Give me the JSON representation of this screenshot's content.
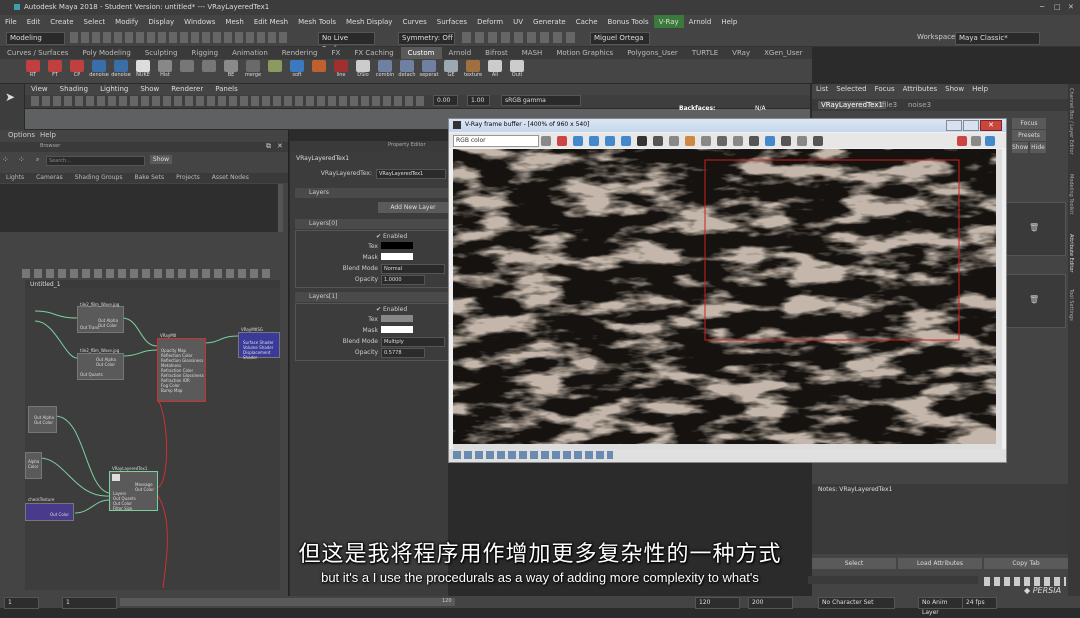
{
  "window": {
    "title": "Autodesk Maya 2018 - Student Version: untitled*  ---  VRayLayeredTex1",
    "workspace_label": "Workspace :",
    "workspace_value": "Maya Classic*"
  },
  "menu": [
    "File",
    "Edit",
    "Create",
    "Select",
    "Modify",
    "Display",
    "Windows",
    "Mesh",
    "Edit Mesh",
    "Mesh Tools",
    "Mesh Display",
    "Curves",
    "Surfaces",
    "Deform",
    "UV",
    "Generate",
    "Cache",
    "Bonus Tools",
    "V-Ray",
    "Arnold",
    "Help"
  ],
  "statusline": {
    "mode": "Modeling",
    "live_surface": "No Live Surface",
    "symmetry": "Symmetry: Off",
    "user": "Miguel Ortega"
  },
  "shelf_tabs": [
    "Curves / Surfaces",
    "Poly Modeling",
    "Sculpting",
    "Rigging",
    "Animation",
    "Rendering",
    "FX",
    "FX Caching",
    "Custom",
    "Arnold",
    "Bifrost",
    "MASH",
    "Motion Graphics",
    "Polygons_User",
    "TURTLE",
    "VRay",
    "XGen_User",
    "XGen"
  ],
  "shelf_active": "Custom",
  "shelf_buttons": [
    {
      "label": "RT",
      "color": "#c04040"
    },
    {
      "label": "FT",
      "color": "#c04040"
    },
    {
      "label": "CP",
      "color": "#c04040"
    },
    {
      "label": "denoise",
      "color": "#3a6ea8"
    },
    {
      "label": "denoise",
      "color": "#3a6ea8"
    },
    {
      "label": "NUKE",
      "color": "#dddddd"
    },
    {
      "label": "Hist",
      "color": "#888888"
    },
    {
      "label": "",
      "color": "#777777"
    },
    {
      "label": "",
      "color": "#777777"
    },
    {
      "label": "BE",
      "color": "#8a8a8a"
    },
    {
      "label": "merge",
      "color": "#6a6a6a"
    },
    {
      "label": "",
      "color": "#8a9a60"
    },
    {
      "label": "soft",
      "color": "#3a7ac0"
    },
    {
      "label": "",
      "color": "#c06030"
    },
    {
      "label": "line",
      "color": "#a03030"
    },
    {
      "label": "DSlo",
      "color": "#cccccc"
    },
    {
      "label": "combin",
      "color": "#7080a0"
    },
    {
      "label": "detach",
      "color": "#7080a0"
    },
    {
      "label": "seperat",
      "color": "#7080a0"
    },
    {
      "label": "GE",
      "color": "#9aaab0"
    },
    {
      "label": "texture",
      "color": "#a07040"
    },
    {
      "label": "All",
      "color": "#cccccc"
    },
    {
      "label": "Outl",
      "color": "#cccccc"
    }
  ],
  "panel_menu": [
    "View",
    "Shading",
    "Lighting",
    "Show",
    "Renderer",
    "Panels"
  ],
  "view_tools": {
    "exposure": "0.00",
    "gamma": "1.00",
    "color_space": "sRGB gamma"
  },
  "viewport": {
    "backfaces_label": "Backfaces:",
    "backfaces_value": "N/A"
  },
  "right_panel": {
    "menu": [
      "List",
      "Selected",
      "Focus",
      "Attributes",
      "Show",
      "Help"
    ],
    "tabs": [
      "VRayLayeredTex1",
      "file3",
      "noise3"
    ],
    "buttons": {
      "focus": "Focus",
      "presets": "Presets",
      "show": "Show",
      "hide": "Hide"
    },
    "notes_label": "Notes:  VRayLayeredTex1",
    "bottom_buttons": [
      "Select",
      "Load Attributes",
      "Copy Tab"
    ]
  },
  "side_labels": [
    "Channel Box / Layer Editor",
    "Modeling Toolkit",
    "Attribute Editor",
    "Tool Settings"
  ],
  "hypershade": {
    "menu": [
      "Options",
      "Help"
    ],
    "browser_label": "Browser",
    "search_placeholder": "Search...",
    "show_button": "Show",
    "tabs": [
      "Lights",
      "Cameras",
      "Shading Groups",
      "Bake Sets",
      "Projects",
      "Asset Nodes"
    ],
    "graph_tab": "Untitled_1"
  },
  "nodes": {
    "n1_title": "tile2_fBm_Wave.jpg",
    "n1_ports": [
      "Out Alpha",
      "Out Color",
      "Out Trans"
    ],
    "n2_title": "tile2_fBm_Wave.jpg",
    "n2_ports": [
      "Out Alpha",
      "Out Color",
      "Out Quants"
    ],
    "shader_title": "VRayMtl",
    "shader_ports": [
      "Opacity Map",
      "Reflection Color",
      "Reflection Glossiness",
      "Metalness",
      "Refraction Color",
      "Refraction Glossiness",
      "Refraction IOR",
      "Fog Color",
      "Bump Map"
    ],
    "sg_title": "VRayMtlSG",
    "sg_ports": [
      "Surface Shader",
      "Volume Shader",
      "Displacement Shader"
    ],
    "layered_title": "VRayLayeredTex1",
    "layered_ports": [
      "Layers",
      "Out Quants",
      "Out Color",
      "Filter Size"
    ],
    "layered_out": [
      "Message",
      "Out Color"
    ],
    "n3_ports": [
      "Out Alpha",
      "Out Color"
    ],
    "n4_ports": [
      "Alpha",
      "Color"
    ],
    "n5_title": "checkTexture",
    "n5_ports": [
      "Out Color"
    ]
  },
  "property_editor": {
    "title": "Property Editor",
    "node_name": "VRayLayeredTex1",
    "field_label": "VRayLayeredTex:",
    "field_value": "VRayLayeredTex1",
    "layers_section": "Layers",
    "add_new": "Add New Layer",
    "layer0": {
      "header": "Layers[0]",
      "enabled": "Enabled",
      "tex": "Tex",
      "mask": "Mask",
      "blend_label": "Blend Mode",
      "blend": "Normal",
      "opacity_label": "Opacity",
      "opacity": "1.0000"
    },
    "layer1": {
      "header": "Layers[1]",
      "enabled": "Enabled",
      "tex": "Tex",
      "mask": "Mask",
      "blend_label": "Blend Mode",
      "blend": "Multiply",
      "opacity_label": "Opacity",
      "opacity": "0.5778"
    }
  },
  "vfb": {
    "title": "V-Ray frame buffer - [400% of 960 x 540]",
    "channel": "RGB color"
  },
  "timeline": {
    "start": "1",
    "current": "1",
    "range_start": "1",
    "range_end": "120",
    "end": "120",
    "max": "200",
    "character_set": "No Character Set",
    "anim_layer": "No Anim Layer",
    "fps": "24 fps"
  },
  "subtitles": {
    "cn": "但这是我将程序用作增加更多复杂性的一种方式",
    "en": "but it's a I use the procedurals as a way of adding more complexity to what's"
  }
}
